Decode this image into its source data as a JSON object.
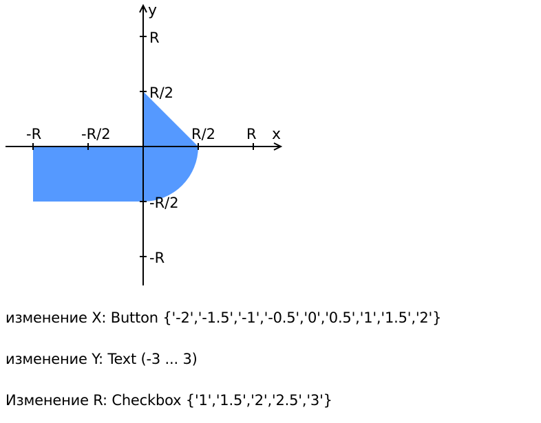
{
  "diagram": {
    "axis_x_label": "x",
    "axis_y_label": "y",
    "tick_x_neg_r": "-R",
    "tick_x_neg_half": "-R/2",
    "tick_x_pos_half": "R/2",
    "tick_x_pos_r": "R",
    "tick_y_pos_r": "R",
    "tick_y_pos_half": "R/2",
    "tick_y_neg_half": "-R/2",
    "tick_y_neg_r": "-R",
    "area_color": "#5599ff"
  },
  "spec": {
    "line_x": "изменение X: Button {'-2','-1.5','-1','-0.5','0','0.5','1','1.5','2'}",
    "line_y": "изменение Y: Text (-3 ... 3)",
    "line_r": "Изменение R: Checkbox {'1','1.5','2','2.5','3'}"
  }
}
